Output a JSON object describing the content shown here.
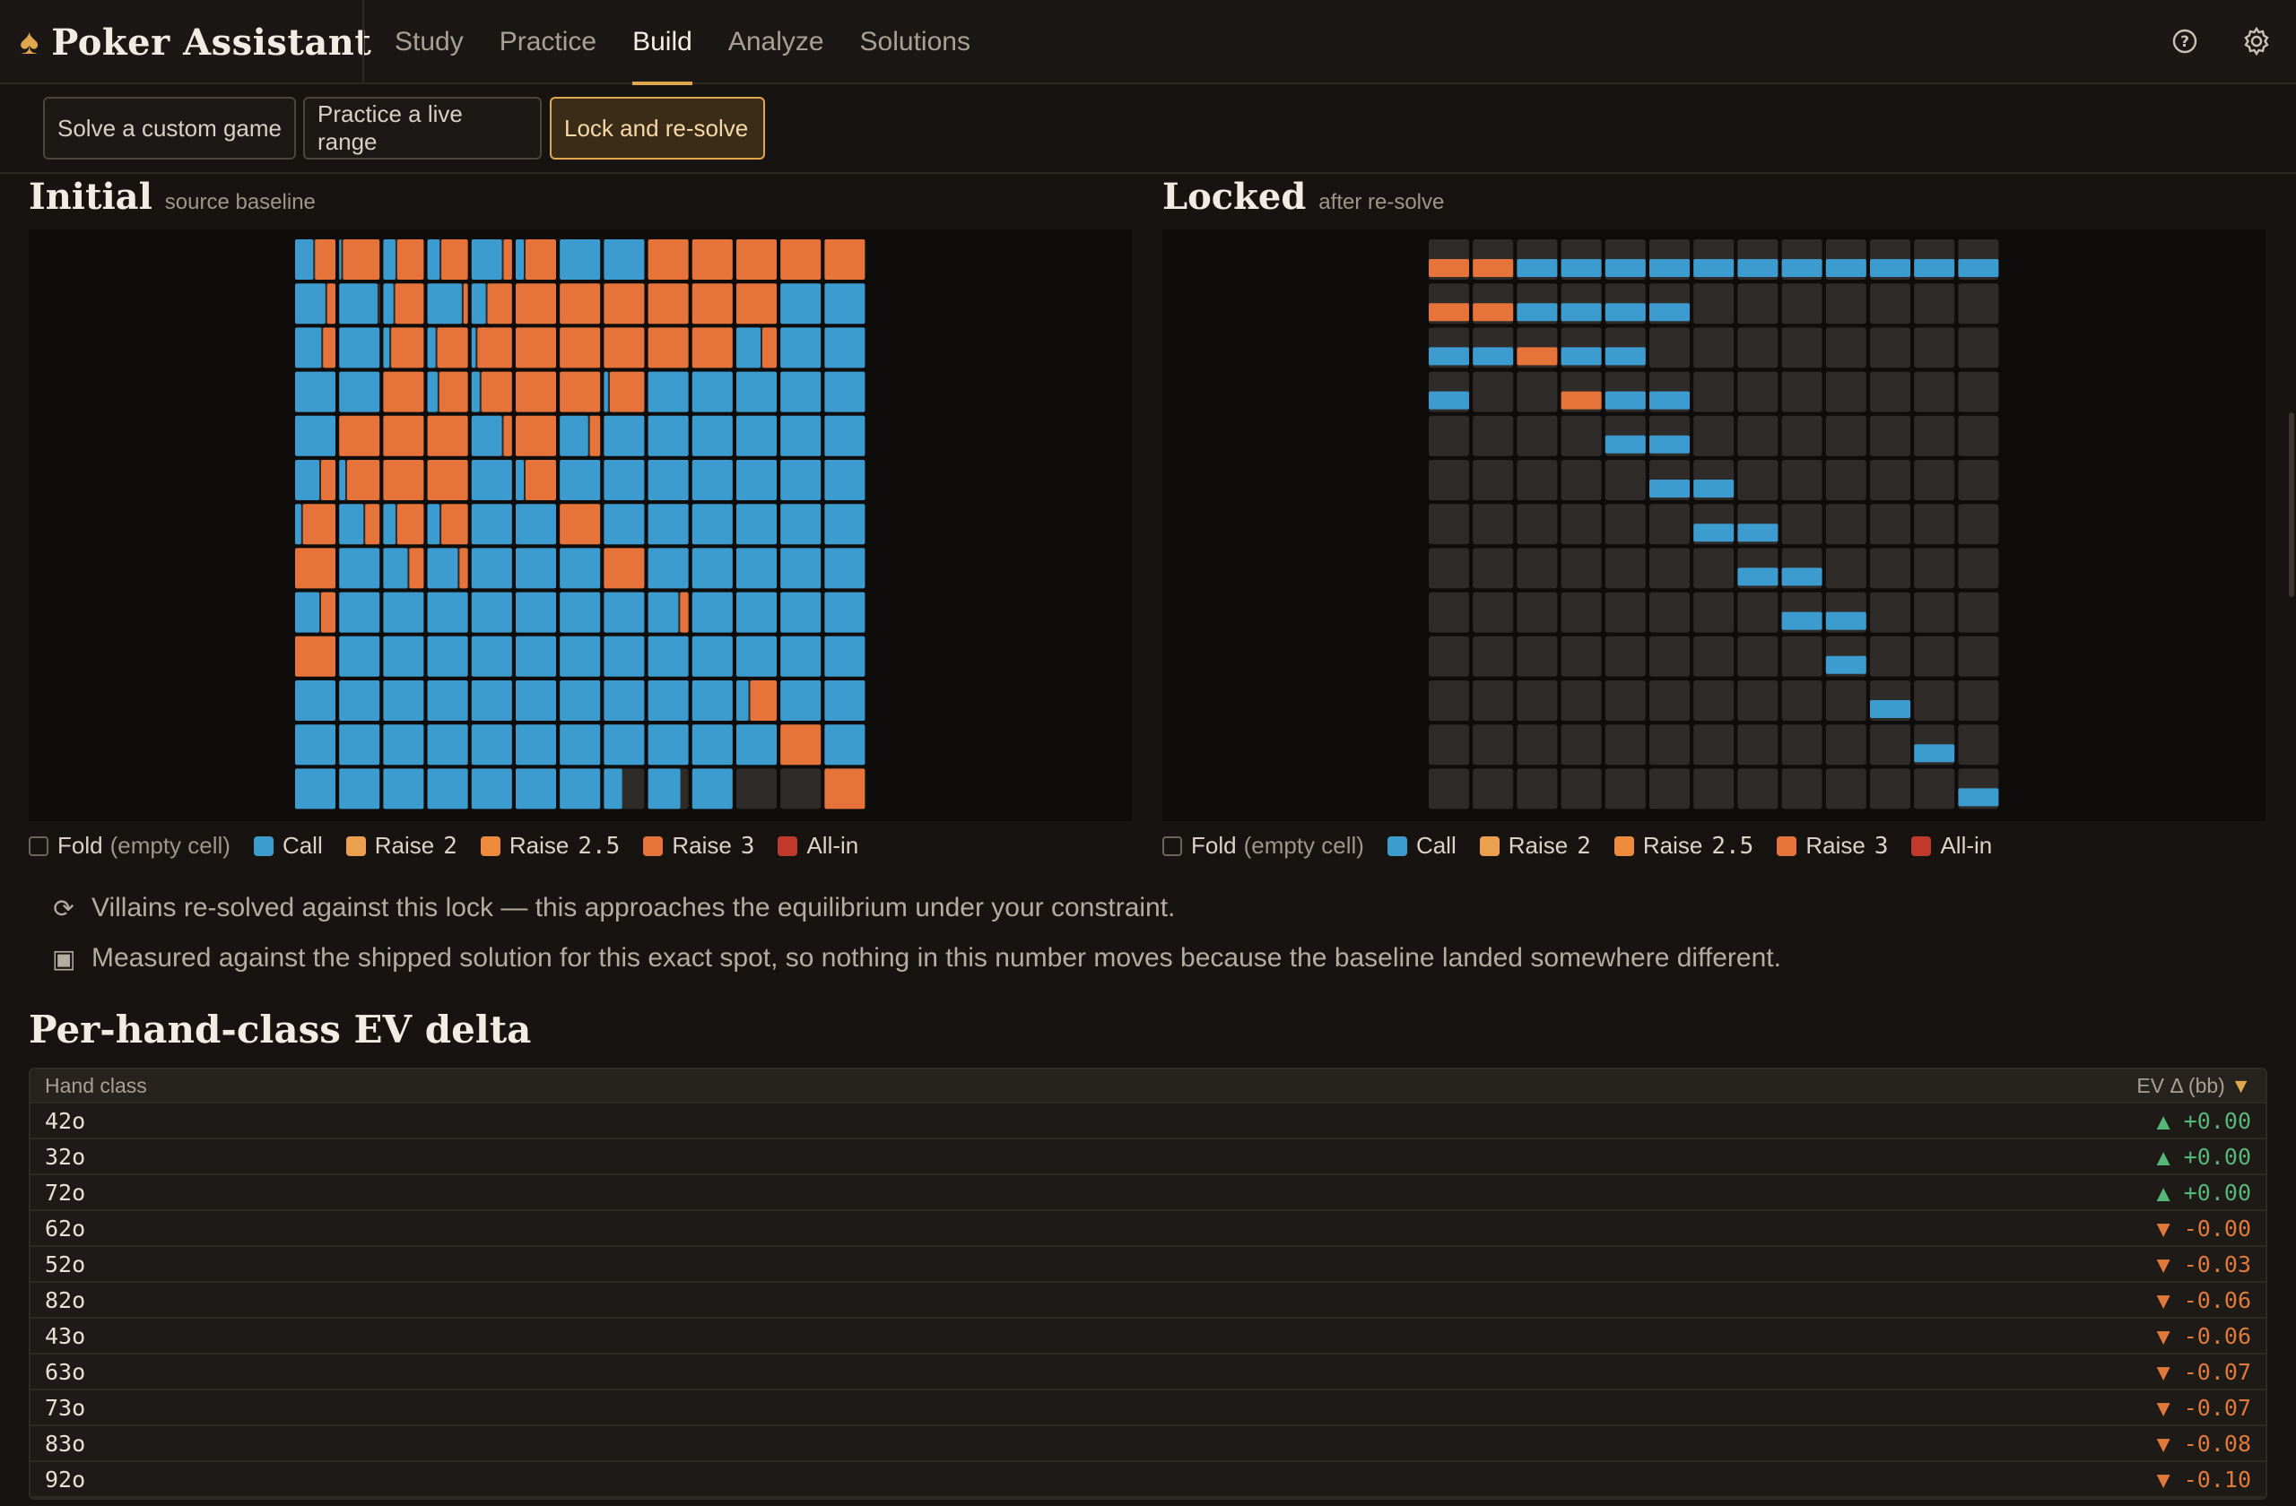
{
  "app": {
    "title": "Poker Assistant",
    "logo_icon": "spade-icon"
  },
  "nav": {
    "tabs": [
      {
        "label": "Study",
        "active": false
      },
      {
        "label": "Practice",
        "active": false
      },
      {
        "label": "Build",
        "active": true
      },
      {
        "label": "Analyze",
        "active": false
      },
      {
        "label": "Solutions",
        "active": false
      }
    ]
  },
  "toolbar": {
    "buttons": [
      {
        "label": "Solve a custom game",
        "active": false
      },
      {
        "label": "Practice a live range",
        "active": false
      },
      {
        "label": "Lock and re-solve",
        "active": true
      }
    ]
  },
  "colors": {
    "call": "#3c9ccf",
    "raise2": "#eaa04e",
    "raise25": "#ee8a3c",
    "raise3": "#e5733a",
    "allin": "#c0392b",
    "fold_cell": "#2f2b28",
    "accent": "#e0a84e"
  },
  "initial": {
    "title": "Initial",
    "subtitle": "source baseline",
    "grid": [
      [
        [
          0.45,
          0.55
        ],
        [
          0.05,
          0.95
        ],
        [
          0.3,
          0.7
        ],
        [
          0.3,
          0.7
        ],
        [
          0.75,
          0.25
        ],
        [
          0.2,
          0.8
        ],
        [
          1,
          0
        ],
        [
          1,
          0
        ],
        [
          0,
          1
        ],
        [
          0,
          1
        ],
        [
          0,
          1
        ],
        [
          0,
          1
        ],
        [
          0,
          1
        ]
      ],
      [
        [
          0.75,
          0.25
        ],
        [
          0.95,
          0.05
        ],
        [
          0.25,
          0.75
        ],
        [
          0.85,
          0.15
        ],
        [
          0.35,
          0.65
        ],
        [
          0,
          1
        ],
        [
          0,
          1
        ],
        [
          0,
          1
        ],
        [
          0,
          1
        ],
        [
          0,
          1
        ],
        [
          0,
          1
        ],
        [
          1,
          0
        ],
        [
          1,
          0
        ]
      ],
      [
        [
          0.65,
          0.35
        ],
        [
          1,
          0
        ],
        [
          0.15,
          0.85
        ],
        [
          0.2,
          0.8
        ],
        [
          0.1,
          0.9
        ],
        [
          0,
          1
        ],
        [
          0,
          1
        ],
        [
          0,
          1
        ],
        [
          0,
          1
        ],
        [
          0,
          1
        ],
        [
          0.6,
          0.4
        ],
        [
          1,
          0
        ],
        [
          1,
          0
        ]
      ],
      [
        [
          1,
          0
        ],
        [
          1,
          0
        ],
        [
          0,
          1
        ],
        [
          0.25,
          0.75
        ],
        [
          0.2,
          0.8
        ],
        [
          0,
          1
        ],
        [
          0,
          1
        ],
        [
          0.1,
          0.9
        ],
        [
          1,
          0
        ],
        [
          1,
          0
        ],
        [
          1,
          0
        ],
        [
          1,
          0
        ],
        [
          1,
          0
        ]
      ],
      [
        [
          1,
          0
        ],
        [
          0,
          1
        ],
        [
          0,
          1
        ],
        [
          0,
          1
        ],
        [
          0.75,
          0.25
        ],
        [
          0,
          1
        ],
        [
          0.7,
          0.3
        ],
        [
          1,
          0
        ],
        [
          1,
          0
        ],
        [
          1,
          0
        ],
        [
          1,
          0
        ],
        [
          1,
          0
        ],
        [
          1,
          0
        ]
      ],
      [
        [
          0.6,
          0.4
        ],
        [
          0.15,
          0.85
        ],
        [
          0,
          1
        ],
        [
          0,
          1
        ],
        [
          1,
          0
        ],
        [
          0.2,
          0.8
        ],
        [
          1,
          0
        ],
        [
          1,
          0
        ],
        [
          1,
          0
        ],
        [
          1,
          0
        ],
        [
          1,
          0
        ],
        [
          1,
          0
        ],
        [
          1,
          0
        ]
      ],
      [
        [
          0.15,
          0.85
        ],
        [
          0.6,
          0.4
        ],
        [
          0.3,
          0.7
        ],
        [
          0.3,
          0.7
        ],
        [
          1,
          0
        ],
        [
          1,
          0
        ],
        [
          0,
          1
        ],
        [
          1,
          0
        ],
        [
          1,
          0
        ],
        [
          1,
          0
        ],
        [
          1,
          0
        ],
        [
          1,
          0
        ],
        [
          1,
          0
        ]
      ],
      [
        [
          0,
          1
        ],
        [
          1,
          0
        ],
        [
          0.6,
          0.4
        ],
        [
          0.75,
          0.25
        ],
        [
          1,
          0
        ],
        [
          1,
          0
        ],
        [
          1,
          0
        ],
        [
          0,
          1
        ],
        [
          1,
          0
        ],
        [
          1,
          0
        ],
        [
          1,
          0
        ],
        [
          1,
          0
        ],
        [
          1,
          0
        ]
      ],
      [
        [
          0.6,
          0.4
        ],
        [
          1,
          0
        ],
        [
          1,
          0
        ],
        [
          1,
          0
        ],
        [
          1,
          0
        ],
        [
          1,
          0
        ],
        [
          1,
          0
        ],
        [
          1,
          0
        ],
        [
          0.75,
          0.25
        ],
        [
          1,
          0
        ],
        [
          1,
          0
        ],
        [
          1,
          0
        ],
        [
          1,
          0
        ]
      ],
      [
        [
          0,
          1
        ],
        [
          1,
          0
        ],
        [
          1,
          0
        ],
        [
          1,
          0
        ],
        [
          1,
          0
        ],
        [
          1,
          0
        ],
        [
          1,
          0
        ],
        [
          1,
          0
        ],
        [
          1,
          0
        ],
        [
          1,
          0
        ],
        [
          1,
          0
        ],
        [
          1,
          0
        ],
        [
          1,
          0
        ]
      ],
      [
        [
          1,
          0
        ],
        [
          1,
          0
        ],
        [
          1,
          0
        ],
        [
          1,
          0
        ],
        [
          1,
          0
        ],
        [
          1,
          0
        ],
        [
          1,
          0
        ],
        [
          1,
          0
        ],
        [
          1,
          0
        ],
        [
          1,
          0
        ],
        [
          0.3,
          0.7
        ],
        [
          1,
          0
        ],
        [
          1,
          0
        ]
      ],
      [
        [
          1,
          0
        ],
        [
          1,
          0
        ],
        [
          1,
          0
        ],
        [
          1,
          0
        ],
        [
          1,
          0
        ],
        [
          1,
          0
        ],
        [
          1,
          0
        ],
        [
          1,
          0
        ],
        [
          1,
          0
        ],
        [
          1,
          0
        ],
        [
          1,
          0
        ],
        [
          0,
          1
        ],
        [
          1,
          0
        ]
      ],
      [
        [
          1,
          0
        ],
        [
          1,
          0
        ],
        [
          1,
          0
        ],
        [
          1,
          0
        ],
        [
          1,
          0
        ],
        [
          1,
          0
        ],
        [
          1,
          0
        ],
        [
          0.45,
          0
        ],
        [
          0.8,
          0
        ],
        [
          1,
          0
        ],
        [
          0,
          0
        ],
        [
          0,
          0
        ],
        [
          0,
          1
        ]
      ]
    ]
  },
  "locked": {
    "title": "Locked",
    "subtitle": "after re-solve",
    "cells": [
      [
        0,
        0,
        "raise3"
      ],
      [
        0,
        1,
        "raise3"
      ],
      [
        0,
        2,
        "call"
      ],
      [
        0,
        3,
        "call"
      ],
      [
        0,
        4,
        "call"
      ],
      [
        0,
        5,
        "call"
      ],
      [
        0,
        6,
        "call"
      ],
      [
        0,
        7,
        "call"
      ],
      [
        0,
        8,
        "call"
      ],
      [
        0,
        9,
        "call"
      ],
      [
        0,
        10,
        "call"
      ],
      [
        0,
        11,
        "call"
      ],
      [
        0,
        12,
        "call"
      ],
      [
        1,
        0,
        "raise3"
      ],
      [
        1,
        1,
        "raise3"
      ],
      [
        1,
        2,
        "call"
      ],
      [
        1,
        3,
        "call"
      ],
      [
        1,
        4,
        "call"
      ],
      [
        1,
        5,
        "call"
      ],
      [
        2,
        0,
        "call"
      ],
      [
        2,
        1,
        "call"
      ],
      [
        2,
        2,
        "raise3"
      ],
      [
        2,
        3,
        "call"
      ],
      [
        2,
        4,
        "call"
      ],
      [
        3,
        0,
        "call"
      ],
      [
        3,
        3,
        "raise3"
      ],
      [
        3,
        4,
        "call"
      ],
      [
        3,
        5,
        "call"
      ],
      [
        4,
        4,
        "call"
      ],
      [
        4,
        5,
        "call"
      ],
      [
        5,
        5,
        "call"
      ],
      [
        5,
        6,
        "call"
      ],
      [
        6,
        6,
        "call"
      ],
      [
        6,
        7,
        "call"
      ],
      [
        7,
        7,
        "call"
      ],
      [
        7,
        8,
        "call"
      ],
      [
        8,
        8,
        "call"
      ],
      [
        8,
        9,
        "call"
      ],
      [
        9,
        9,
        "call"
      ],
      [
        10,
        10,
        "call"
      ],
      [
        11,
        11,
        "call"
      ],
      [
        12,
        12,
        "call"
      ]
    ]
  },
  "legend": {
    "fold_label": "Fold",
    "fold_hint": "(empty cell)",
    "items": [
      {
        "label": "Call",
        "color": "#3c9ccf"
      },
      {
        "label": "Raise",
        "size": "2",
        "color": "#eaa04e"
      },
      {
        "label": "Raise",
        "size": "2.5",
        "color": "#ee8a3c"
      },
      {
        "label": "Raise",
        "size": "3",
        "color": "#e5733a"
      },
      {
        "label": "All-in",
        "color": "#c0392b"
      }
    ]
  },
  "notes": [
    {
      "icon": "refresh-icon",
      "text": "Villains re-solved against this lock — this approaches the equilibrium under your constraint."
    },
    {
      "icon": "square-icon",
      "text": "Measured against the shipped solution for this exact spot, so nothing in this number moves because the baseline landed somewhere different."
    }
  ],
  "ev_table": {
    "title": "Per-hand-class EV delta",
    "col_hand": "Hand class",
    "col_ev": "EV Δ (bb)",
    "sort_icon": "▼",
    "rows": [
      {
        "hand": "42o",
        "arrow": "▲",
        "value": "+0.00",
        "dir": "up"
      },
      {
        "hand": "32o",
        "arrow": "▲",
        "value": "+0.00",
        "dir": "up"
      },
      {
        "hand": "72o",
        "arrow": "▲",
        "value": "+0.00",
        "dir": "up"
      },
      {
        "hand": "62o",
        "arrow": "▼",
        "value": "-0.00",
        "dir": "down"
      },
      {
        "hand": "52o",
        "arrow": "▼",
        "value": "-0.03",
        "dir": "down"
      },
      {
        "hand": "82o",
        "arrow": "▼",
        "value": "-0.06",
        "dir": "down"
      },
      {
        "hand": "43o",
        "arrow": "▼",
        "value": "-0.06",
        "dir": "down"
      },
      {
        "hand": "63o",
        "arrow": "▼",
        "value": "-0.07",
        "dir": "down"
      },
      {
        "hand": "73o",
        "arrow": "▼",
        "value": "-0.07",
        "dir": "down"
      },
      {
        "hand": "83o",
        "arrow": "▼",
        "value": "-0.08",
        "dir": "down"
      },
      {
        "hand": "92o",
        "arrow": "▼",
        "value": "-0.10",
        "dir": "down"
      }
    ]
  }
}
